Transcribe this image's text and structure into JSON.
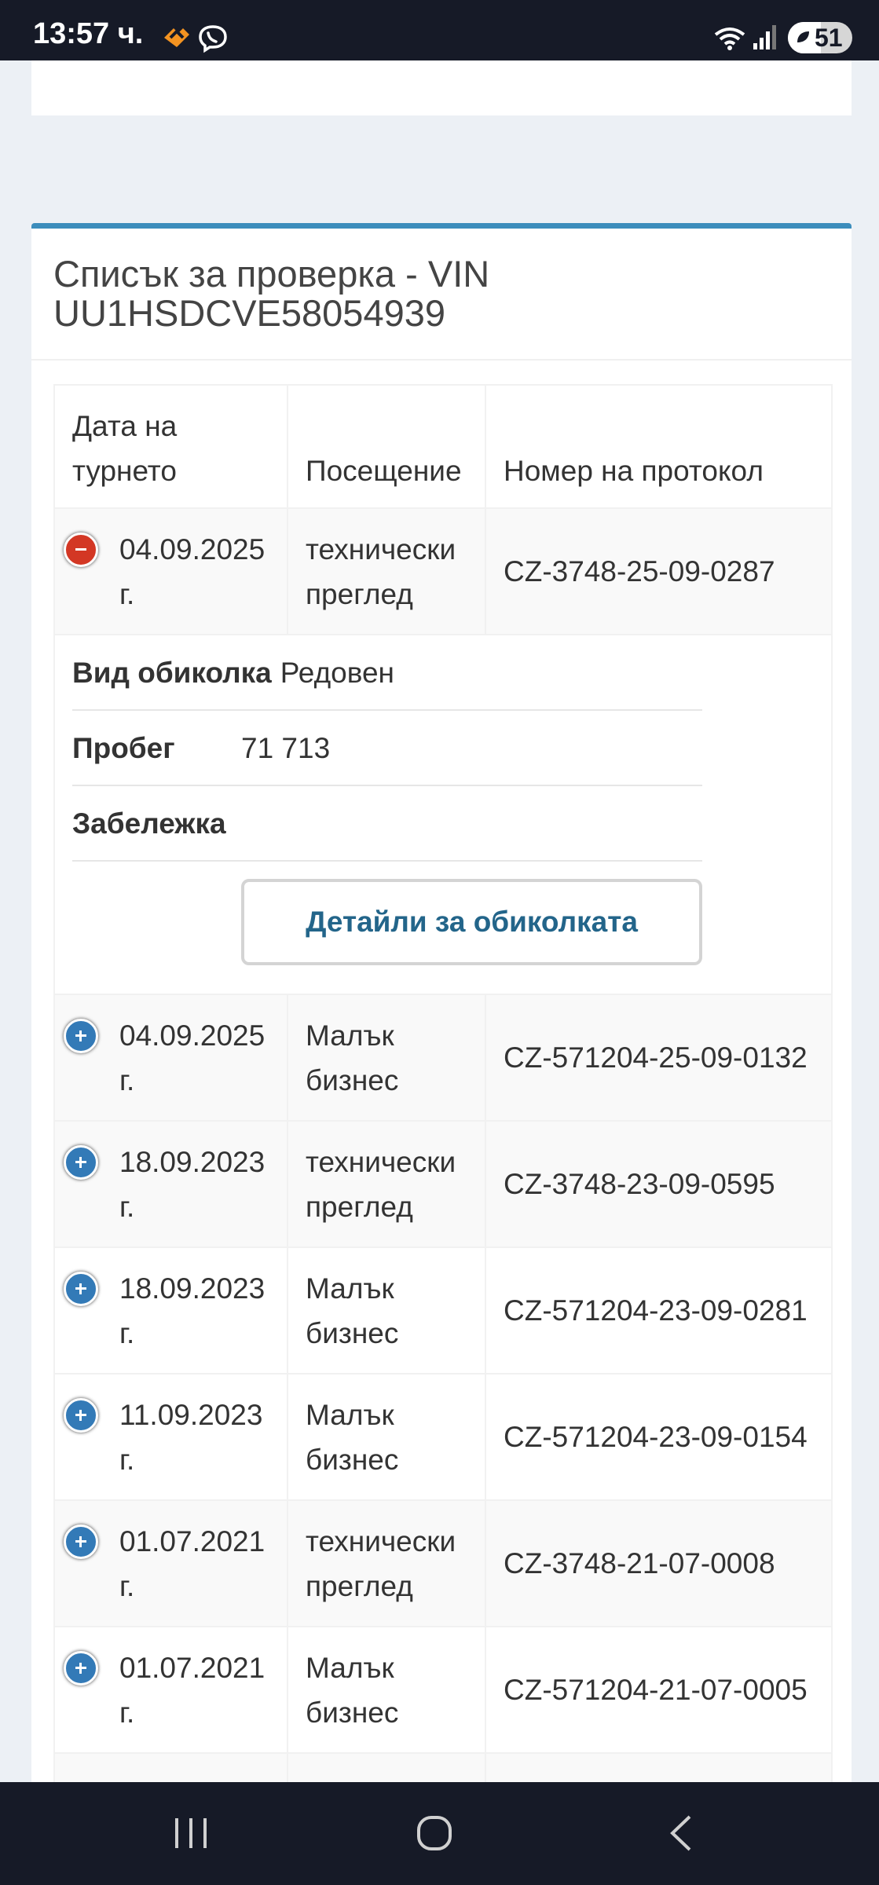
{
  "status_bar": {
    "time": "13:57 ч.",
    "battery": "51",
    "icons": [
      "heart-app-icon",
      "viber-icon",
      "wifi-icon",
      "signal-icon",
      "battery-saver-leaf-icon"
    ]
  },
  "panel": {
    "title": "Списък за проверка - VIN UU1HSDCVE58054939",
    "accent_color": "#3c8dbc"
  },
  "table": {
    "headers": [
      "Дата на турнето",
      "Посещение",
      "Номер на протокол"
    ],
    "expanded_row": {
      "date": "04.09.2025 г.",
      "visit": "технически преглед",
      "protocol": "CZ-3748-25-09-0287",
      "details": {
        "tour_type_label": "Вид обиколка",
        "tour_type_value": "Редовен",
        "mileage_label": "Пробег",
        "mileage_value": "71 713",
        "note_label": "Забележка",
        "note_value": "",
        "button_label": "Детайли за обиколката"
      }
    },
    "rows": [
      {
        "date": "04.09.2025 г.",
        "visit": "Малък бизнес",
        "protocol": "CZ-571204-25-09-0132"
      },
      {
        "date": "18.09.2023 г.",
        "visit": "технически преглед",
        "protocol": "CZ-3748-23-09-0595"
      },
      {
        "date": "18.09.2023 г.",
        "visit": "Малък бизнес",
        "protocol": "CZ-571204-23-09-0281"
      },
      {
        "date": "11.09.2023 г.",
        "visit": "Малък бизнес",
        "protocol": "CZ-571204-23-09-0154"
      },
      {
        "date": "01.07.2021 г.",
        "visit": "технически преглед",
        "protocol": "CZ-3748-21-07-0008"
      },
      {
        "date": "01.07.2021 г.",
        "visit": "Малък бизнес",
        "protocol": "CZ-571204-21-07-0005"
      }
    ]
  },
  "nav_bar": {
    "icons": [
      "recent-apps-icon",
      "home-icon",
      "back-icon"
    ]
  }
}
